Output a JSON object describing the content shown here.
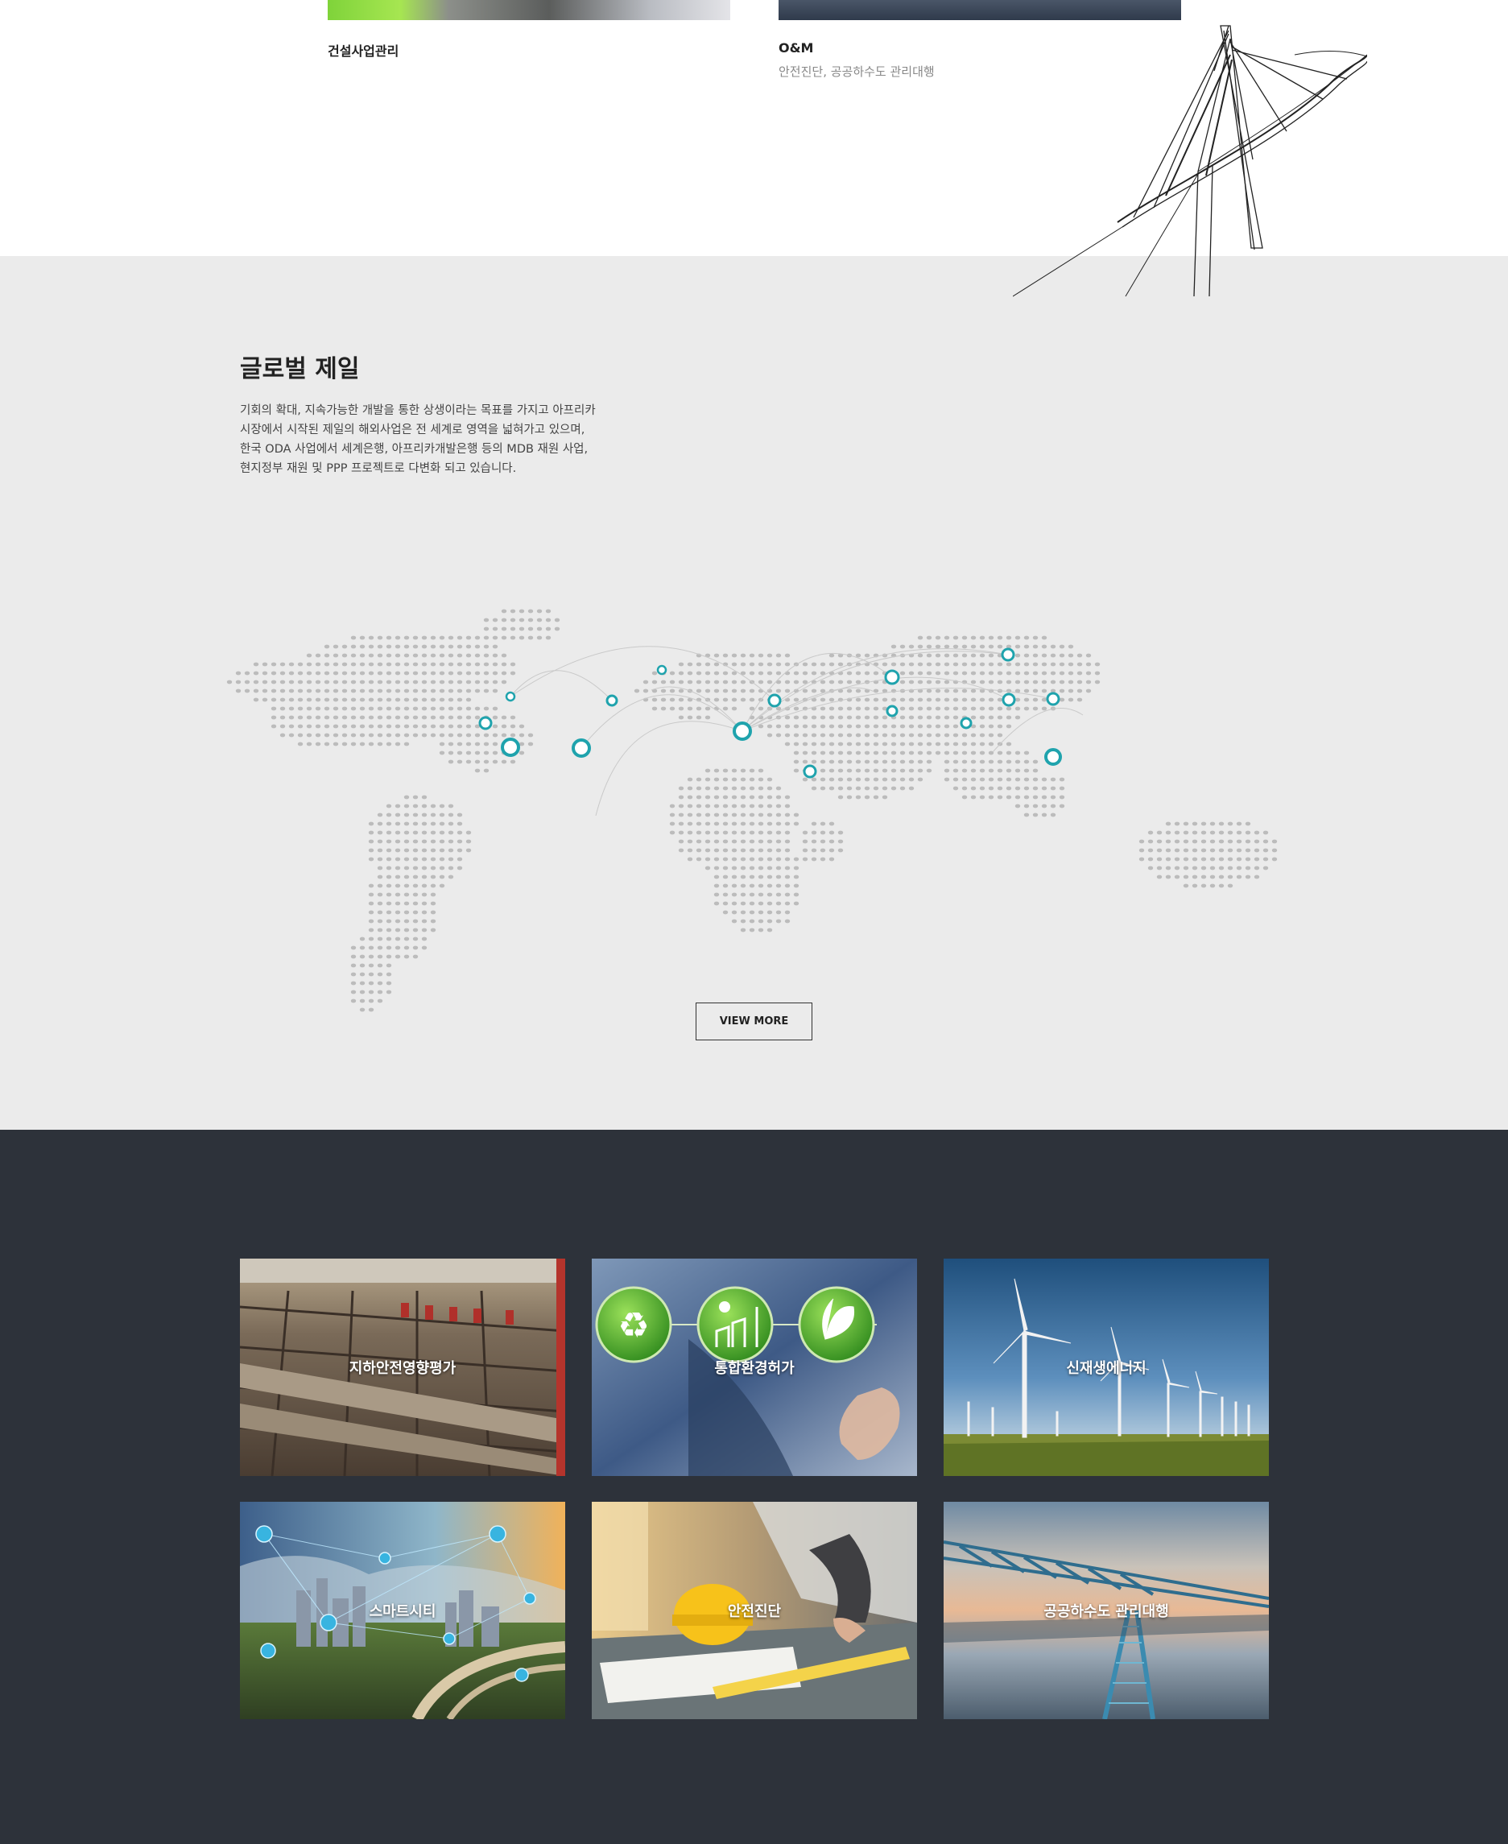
{
  "business_top": {
    "left_item": {
      "title": "건설사업관리"
    },
    "right_item": {
      "title": "O&M",
      "subtitle": "안전진단, 공공하수도 관리대행"
    }
  },
  "global": {
    "title": "글로벌 제일",
    "description_lines": [
      "기회의 확대, 지속가능한 개발을 통한 상생이라는 목표를 가지고 아프리카",
      "시장에서 시작된 제일의 해외사업은 전 세계로 영역을 넓혀가고 있으며,",
      "한국 ODA 사업에서 세계은행, 아프리카개발은행 등의 MDB 재원 사업,",
      "현지정부 재원 및 PPP 프로젝트로 다변화 되고 있습니다."
    ],
    "view_more_label": "VIEW MORE",
    "marker_color": "#1fa3ad"
  },
  "services": {
    "cards": [
      {
        "label": "지하안전영향평가",
        "icon": "construction-site-photo"
      },
      {
        "label": "통합환경허가",
        "icon": "eco-icons-photo"
      },
      {
        "label": "신재생에너지",
        "icon": "wind-turbine-photo"
      },
      {
        "label": "스마트시티",
        "icon": "smart-city-photo"
      },
      {
        "label": "안전진단",
        "icon": "engineer-helmet-photo"
      },
      {
        "label": "공공하수도 관리대행",
        "icon": "water-treatment-photo"
      }
    ]
  },
  "colors": {
    "dark_background": "#2d323a",
    "light_background": "#ebebeb",
    "accent_teal": "#1fa3ad"
  }
}
